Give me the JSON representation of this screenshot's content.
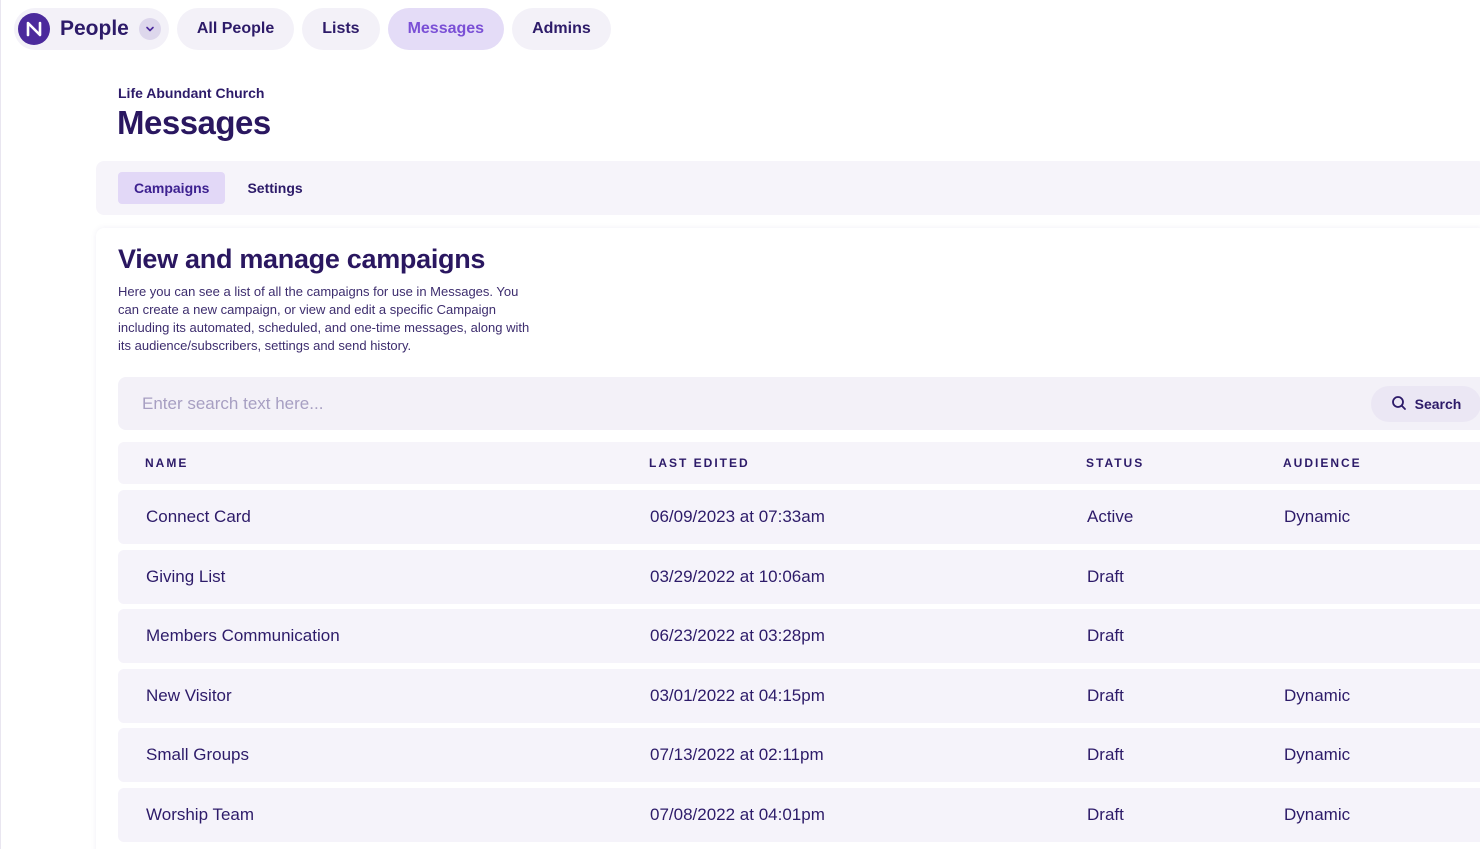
{
  "app": {
    "brand_name": "People",
    "logo_icon": "n-logo-icon",
    "accent_color": "#7a4fd6",
    "primary_color": "#2d1b69"
  },
  "nav": {
    "items": [
      {
        "label": "All People",
        "active": false
      },
      {
        "label": "Lists",
        "active": false
      },
      {
        "label": "Messages",
        "active": true
      },
      {
        "label": "Admins",
        "active": false
      }
    ]
  },
  "header": {
    "org_name": "Life Abundant Church",
    "title": "Messages"
  },
  "subtabs": [
    {
      "label": "Campaigns",
      "active": true
    },
    {
      "label": "Settings",
      "active": false
    }
  ],
  "section": {
    "title": "View and manage campaigns",
    "description": "Here you can see a list of all the campaigns for use in Messages. You can create a new campaign, or view and edit a specific Campaign including its automated, scheduled, and one-time messages, along with its audience/subscribers, settings and send history."
  },
  "search": {
    "placeholder": "Enter search text here...",
    "value": "",
    "button_label": "Search"
  },
  "table": {
    "columns": [
      "NAME",
      "LAST EDITED",
      "STATUS",
      "AUDIENCE"
    ],
    "rows": [
      {
        "name": "Connect Card",
        "last_edited": "06/09/2023 at 07:33am",
        "status": "Active",
        "audience": "Dynamic"
      },
      {
        "name": "Giving List",
        "last_edited": "03/29/2022 at 10:06am",
        "status": "Draft",
        "audience": ""
      },
      {
        "name": "Members Communication",
        "last_edited": "06/23/2022 at 03:28pm",
        "status": "Draft",
        "audience": ""
      },
      {
        "name": "New Visitor",
        "last_edited": "03/01/2022 at 04:15pm",
        "status": "Draft",
        "audience": "Dynamic"
      },
      {
        "name": "Small Groups",
        "last_edited": "07/13/2022 at 02:11pm",
        "status": "Draft",
        "audience": "Dynamic"
      },
      {
        "name": "Worship Team",
        "last_edited": "07/08/2022 at 04:01pm",
        "status": "Draft",
        "audience": "Dynamic"
      }
    ]
  }
}
